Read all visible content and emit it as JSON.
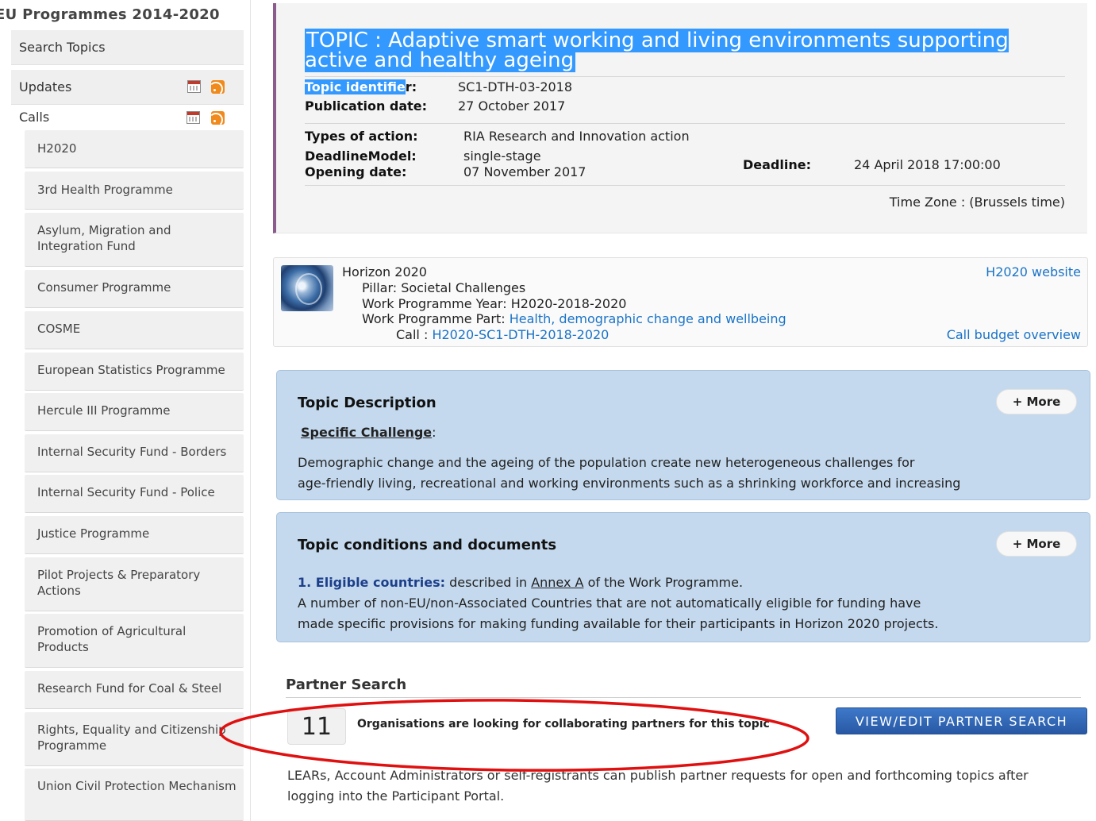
{
  "sidebar": {
    "title": "EU Programmes 2014-2020",
    "search_topics": "Search Topics",
    "updates": "Updates",
    "calls": "Calls",
    "items": [
      "H2020",
      "3rd Health Programme",
      "Asylum, Migration and Integration Fund",
      "Consumer Programme",
      "COSME",
      "European Statistics Programme",
      "Hercule III Programme",
      "Internal Security Fund - Borders",
      "Internal Security Fund - Police",
      "Justice Programme",
      "Pilot Projects & Preparatory Actions",
      "Promotion of Agricultural Products",
      "Research Fund for Coal & Steel",
      "Rights, Equality and Citizenship Programme",
      "Union Civil Protection Mechanism"
    ]
  },
  "topic": {
    "title": "TOPIC : Adaptive smart working and living environments supporting active and healthy ageing",
    "identifier_label": "Topic identifier:",
    "identifier_label_highlight": "Topic identifie",
    "identifier_label_rest": "r:",
    "identifier_value": "SC1-DTH-03-2018",
    "publication_label": "Publication date:",
    "publication_value": "27 October 2017",
    "types_label": "Types of action:",
    "types_value": "RIA Research and Innovation action",
    "deadline_model_label": "DeadlineModel:",
    "deadline_model_value": "single-stage",
    "opening_label": "Opening date:",
    "opening_value": "07 November 2017",
    "deadline_label": "Deadline:",
    "deadline_value": "24 April 2018 17:00:00",
    "timezone": "Time Zone : (Brussels time)"
  },
  "programme": {
    "name": "Horizon 2020",
    "pillar": "Pillar: Societal Challenges",
    "wp_year": "Work Programme Year: H2020-2018-2020",
    "wp_part_label": "Work Programme Part:",
    "wp_part_link": "Health, demographic change and wellbeing",
    "call_label": "Call :",
    "call_link": "H2020-SC1-DTH-2018-2020",
    "website_link": "H2020 website",
    "budget_link": "Call budget overview"
  },
  "description": {
    "title": "Topic Description",
    "more": "+ More",
    "subheading": "Specific Challenge",
    "colon": ":",
    "line1": "Demographic change and the ageing of the population create new heterogeneous challenges for",
    "line2": "age-friendly living, recreational and working environments such as a shrinking workforce and increasing"
  },
  "conditions": {
    "title": "Topic conditions and documents",
    "more": "+ More",
    "item_label": "1. Eligible countries:",
    "item_text_a": "described in",
    "annex_link": "Annex A",
    "item_text_b": "of the Work Programme.",
    "line2": "A number of non-EU/non-Associated Countries that are not automatically eligible for funding have",
    "line3": "made specific provisions for making funding available for their participants in Horizon 2020 projects."
  },
  "partner_search": {
    "title": "Partner Search",
    "count": "11",
    "message": "Organisations are looking for collaborating partners for this topic",
    "button": "VIEW/EDIT PARTNER SEARCH",
    "note": "LEARs, Account Administrators or self-registrants can publish partner requests for open and forthcoming topics after logging into the Participant Portal."
  },
  "colors": {
    "accent_purple": "#8b5b8e",
    "panel_blue": "#c4d9ee",
    "link_blue": "#1a73c7",
    "selection_blue": "#3399ff",
    "annotation_red": "#e01010"
  }
}
